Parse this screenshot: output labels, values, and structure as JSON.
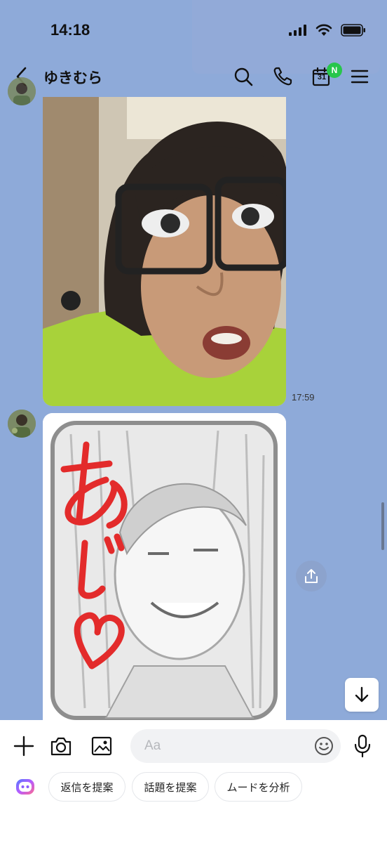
{
  "status_bar": {
    "time": "14:18"
  },
  "header": {
    "title": "ゆきむら",
    "calendar_day": "31",
    "calendar_badge": "N"
  },
  "messages": [
    {
      "type": "photo",
      "time": "17:59"
    },
    {
      "type": "photo",
      "caption": "あじ♡"
    }
  ],
  "input": {
    "placeholder": "Aa"
  },
  "suggestions": [
    {
      "label": "返信を提案"
    },
    {
      "label": "話題を提案"
    },
    {
      "label": "ムードを分析"
    }
  ],
  "colors": {
    "chat_background": "#8eaad9",
    "badge_green": "#27c64b",
    "caption_red": "#e32b2b"
  }
}
